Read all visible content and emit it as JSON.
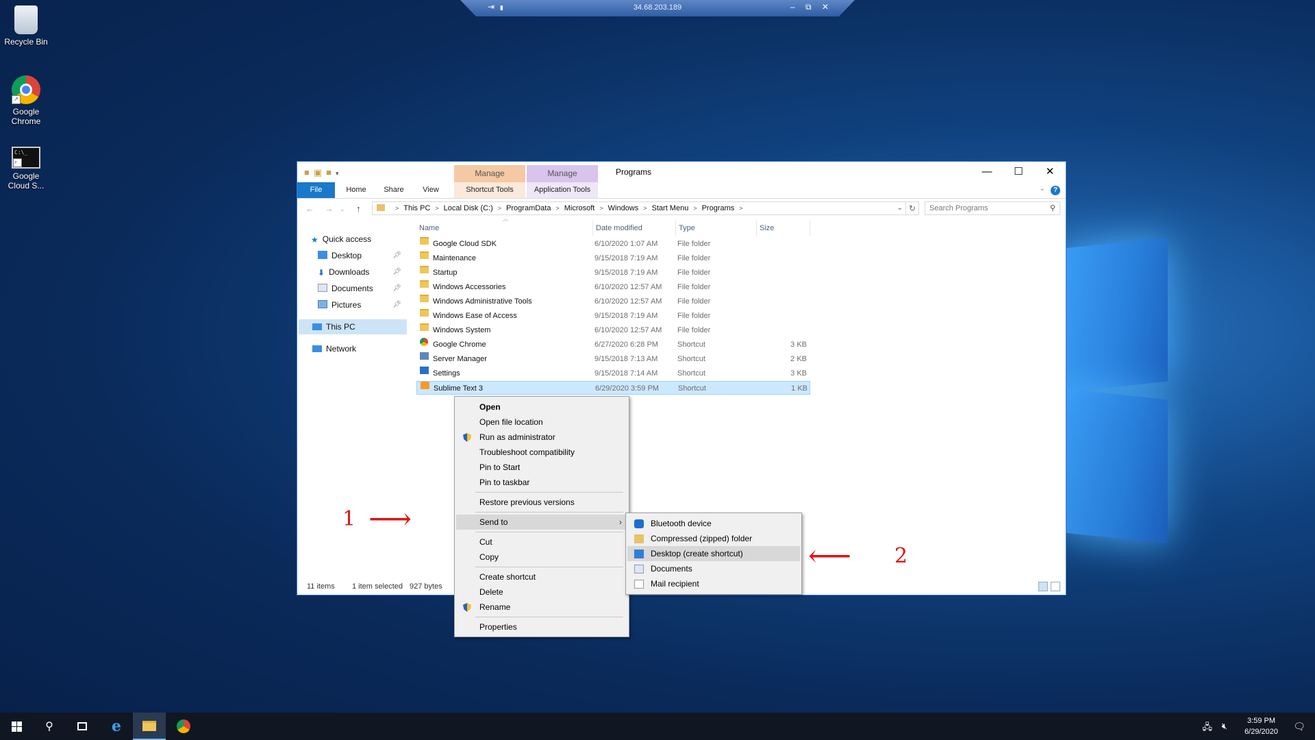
{
  "rdp": {
    "title": "34.68.203.189",
    "pin": "⇥",
    "signal": "▮",
    "min": "–",
    "restore": "⧉",
    "close": "✕"
  },
  "desktop": {
    "icons": [
      {
        "label": "Recycle Bin"
      },
      {
        "label": "Google\nChrome"
      },
      {
        "label": "Google\nCloud S..."
      }
    ]
  },
  "window": {
    "title": "Programs",
    "context_tabs": [
      {
        "label": "Manage"
      },
      {
        "label": "Manage"
      }
    ],
    "ribbon_tabs": [
      "File",
      "Home",
      "Share",
      "View",
      "Shortcut Tools",
      "Application Tools"
    ],
    "help": "?",
    "buttons": {
      "min": "—",
      "max": "☐",
      "close": "✕"
    },
    "breadcrumb": [
      "This PC",
      "Local Disk (C:)",
      "ProgramData",
      "Microsoft",
      "Windows",
      "Start Menu",
      "Programs"
    ],
    "search_placeholder": "Search Programs",
    "nav": {
      "quick_access": "Quick access",
      "items": [
        "Desktop",
        "Downloads",
        "Documents",
        "Pictures"
      ],
      "this_pc": "This PC",
      "network": "Network"
    },
    "columns": {
      "name": "Name",
      "date": "Date modified",
      "type": "Type",
      "size": "Size"
    },
    "rows": [
      {
        "name": "Google Cloud SDK",
        "date": "6/10/2020 1:07 AM",
        "type": "File folder",
        "size": "",
        "icon": "folder"
      },
      {
        "name": "Maintenance",
        "date": "9/15/2018 7:19 AM",
        "type": "File folder",
        "size": "",
        "icon": "folder"
      },
      {
        "name": "Startup",
        "date": "9/15/2018 7:19 AM",
        "type": "File folder",
        "size": "",
        "icon": "folder"
      },
      {
        "name": "Windows Accessories",
        "date": "6/10/2020 12:57 AM",
        "type": "File folder",
        "size": "",
        "icon": "folder"
      },
      {
        "name": "Windows Administrative Tools",
        "date": "6/10/2020 12:57 AM",
        "type": "File folder",
        "size": "",
        "icon": "folder"
      },
      {
        "name": "Windows Ease of Access",
        "date": "9/15/2018 7:19 AM",
        "type": "File folder",
        "size": "",
        "icon": "folder"
      },
      {
        "name": "Windows System",
        "date": "6/10/2020 12:57 AM",
        "type": "File folder",
        "size": "",
        "icon": "folder"
      },
      {
        "name": "Google Chrome",
        "date": "6/27/2020 6:28 PM",
        "type": "Shortcut",
        "size": "3 KB",
        "icon": "chrome"
      },
      {
        "name": "Server Manager",
        "date": "9/15/2018 7:13 AM",
        "type": "Shortcut",
        "size": "2 KB",
        "icon": "server"
      },
      {
        "name": "Settings",
        "date": "9/15/2018 7:14 AM",
        "type": "Shortcut",
        "size": "3 KB",
        "icon": "settings"
      },
      {
        "name": "Sublime Text 3",
        "date": "6/29/2020 3:59 PM",
        "type": "Shortcut",
        "size": "1 KB",
        "icon": "sublime"
      }
    ],
    "status": {
      "count": "11 items",
      "selected": "1 item selected",
      "bytes": "927 bytes"
    }
  },
  "context_menu": {
    "items": [
      "Open",
      "Open file location",
      "Run as administrator",
      "Troubleshoot compatibility",
      "Pin to Start",
      "Pin to taskbar",
      "Restore previous versions",
      "Send to",
      "Cut",
      "Copy",
      "Create shortcut",
      "Delete",
      "Rename",
      "Properties"
    ],
    "arrow": "›"
  },
  "sendto_menu": {
    "items": [
      "Bluetooth device",
      "Compressed (zipped) folder",
      "Desktop (create shortcut)",
      "Documents",
      "Mail recipient"
    ]
  },
  "annotations": {
    "one": "1",
    "arrow_right": "⟶",
    "two": "2",
    "arrow_left": "⟵"
  },
  "taskbar": {
    "time": "3:59 PM",
    "date": "6/29/2020"
  }
}
